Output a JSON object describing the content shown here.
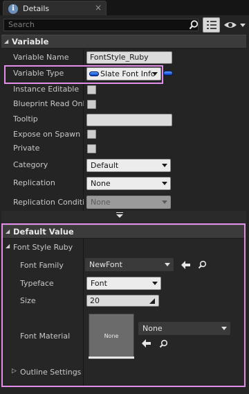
{
  "tab": {
    "title": "Details",
    "info_glyph": "i",
    "close_glyph": "×"
  },
  "search": {
    "placeholder": "Search"
  },
  "sections": {
    "variable": {
      "title": "Variable"
    },
    "default_value": {
      "title": "Default Value"
    }
  },
  "variable": {
    "name_label": "Variable Name",
    "name_value": "FontStyle_Ruby",
    "type_label": "Variable Type",
    "type_value": "Slate Font Info",
    "instance_editable_label": "Instance Editable",
    "blueprint_read_only_label": "Blueprint Read Only",
    "tooltip_label": "Tooltip",
    "tooltip_value": "",
    "expose_on_spawn_label": "Expose on Spawn",
    "private_label": "Private",
    "category_label": "Category",
    "category_value": "Default",
    "replication_label": "Replication",
    "replication_value": "None",
    "replication_condition_label": "Replication Conditio",
    "replication_condition_value": "None"
  },
  "default_value": {
    "font_style_label": "Font Style Ruby",
    "font_family_label": "Font Family",
    "font_family_value": "NewFont",
    "typeface_label": "Typeface",
    "typeface_value": "Font",
    "size_label": "Size",
    "size_value": "20",
    "font_material_label": "Font Material",
    "font_material_thumb_text": "None",
    "font_material_value": "None",
    "outline_settings_label": "Outline Settings"
  },
  "colors": {
    "highlight": "#e38ee8",
    "pin_blue": "#2a6cff"
  },
  "icons": {
    "search": "search-icon",
    "grid": "grid-view-icon",
    "eye": "eye-icon",
    "use_selected": "left-arrow-icon",
    "browse": "magnifier-icon"
  }
}
